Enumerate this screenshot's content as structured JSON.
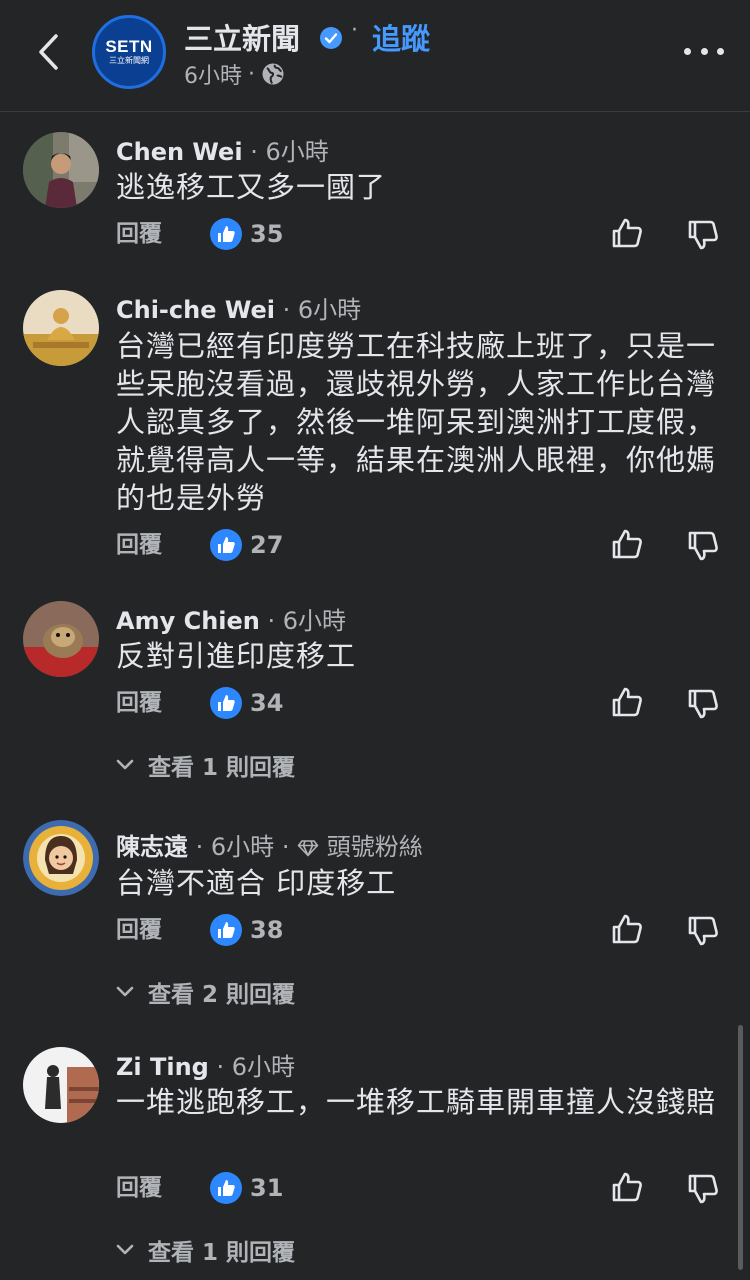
{
  "header": {
    "page_name": "三立新聞",
    "logo_line1": "SETN",
    "logo_line2": "三立新聞網",
    "separator": "·",
    "follow_label": "追蹤",
    "meta_time": "6小時",
    "meta_sep": "·"
  },
  "comments": [
    {
      "name": "Chen Wei",
      "time": "6小時",
      "text": "逃逸移工又多一國了",
      "reply_label": "回覆",
      "likes": "35"
    },
    {
      "name": "Chi-che Wei",
      "time": "6小時",
      "text": "台灣已經有印度勞工在科技廠上班了，只是一些呆胞沒看過，還歧視外勞，人家工作比台灣人認真多了，然後一堆阿呆到澳洲打工度假，就覺得高人一等，結果在澳洲人眼裡，你他媽的也是外勞",
      "reply_label": "回覆",
      "likes": "27"
    },
    {
      "name": "Amy Chien",
      "time": "6小時",
      "text": "反對引進印度移工",
      "reply_label": "回覆",
      "likes": "34",
      "view_replies": "查看 1 則回覆"
    },
    {
      "name": "陳志遠",
      "time": "6小時",
      "badge": "頭號粉絲",
      "text": "台灣不適合 印度移工",
      "reply_label": "回覆",
      "likes": "38",
      "view_replies": "查看 2 則回覆"
    },
    {
      "name": "Zi Ting",
      "time": "6小時",
      "text": "一堆逃跑移工，一堆移工騎車開車撞人沒錢賠",
      "reply_label": "回覆",
      "likes": "31",
      "view_replies": "查看 1 則回覆"
    }
  ],
  "icons": {
    "back": "chevron-left-icon",
    "verified": "verified-badge-icon",
    "globe": "globe-icon",
    "more": "more-horizontal-icon",
    "like": "thumbs-up-icon",
    "dislike": "thumbs-down-icon",
    "expand": "chevron-down-icon",
    "fan": "diamond-icon"
  },
  "colors": {
    "background": "#242526",
    "accent": "#4599ff",
    "like_badge": "#2d88ff",
    "text_primary": "#e4e6eb",
    "text_secondary": "#b0b3b8"
  }
}
